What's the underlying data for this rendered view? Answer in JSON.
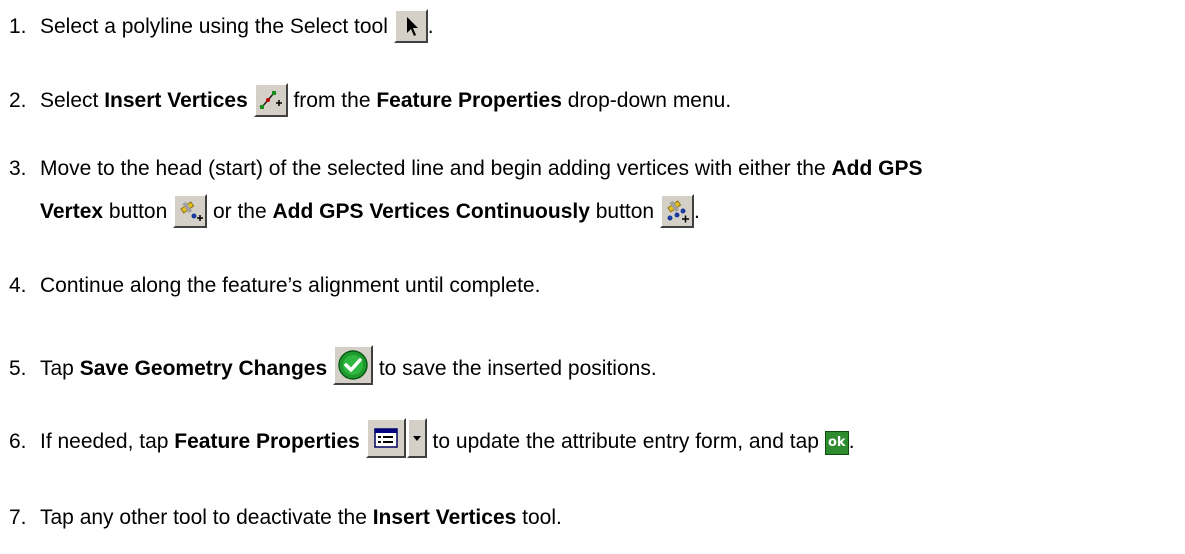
{
  "steps": [
    {
      "num": "1.",
      "t1": "Select a polyline using the Select tool ",
      "t2": "."
    },
    {
      "num": "2.",
      "t1": "Select ",
      "b1": "Insert Vertices",
      "t2": " from the ",
      "b2": "Feature Properties",
      "t3": " drop-down menu."
    },
    {
      "num": "3.",
      "t1": "Move to the head (start) of the selected line and begin adding vertices with either the ",
      "b1": "Add GPS",
      "b2": "Vertex",
      "t2": " button ",
      "t3": " or the ",
      "b3": "Add GPS Vertices Continuously",
      "t4": " button ",
      "t5": "."
    },
    {
      "num": "4.",
      "t1": "Continue along the feature’s alignment until complete."
    },
    {
      "num": "5.",
      "t1": "Tap ",
      "b1": "Save Geometry Changes",
      "t2": " to save the inserted positions."
    },
    {
      "num": "6.",
      "t1": "If needed, tap ",
      "b1": "Feature Properties",
      "t2": " to update the attribute entry form, and tap ",
      "t3": "."
    },
    {
      "num": "7.",
      "t1": "Tap any other tool to deactivate the ",
      "b1": "Insert Vertices",
      "t2": " tool."
    }
  ],
  "icons": {
    "ok_label": "ok"
  }
}
